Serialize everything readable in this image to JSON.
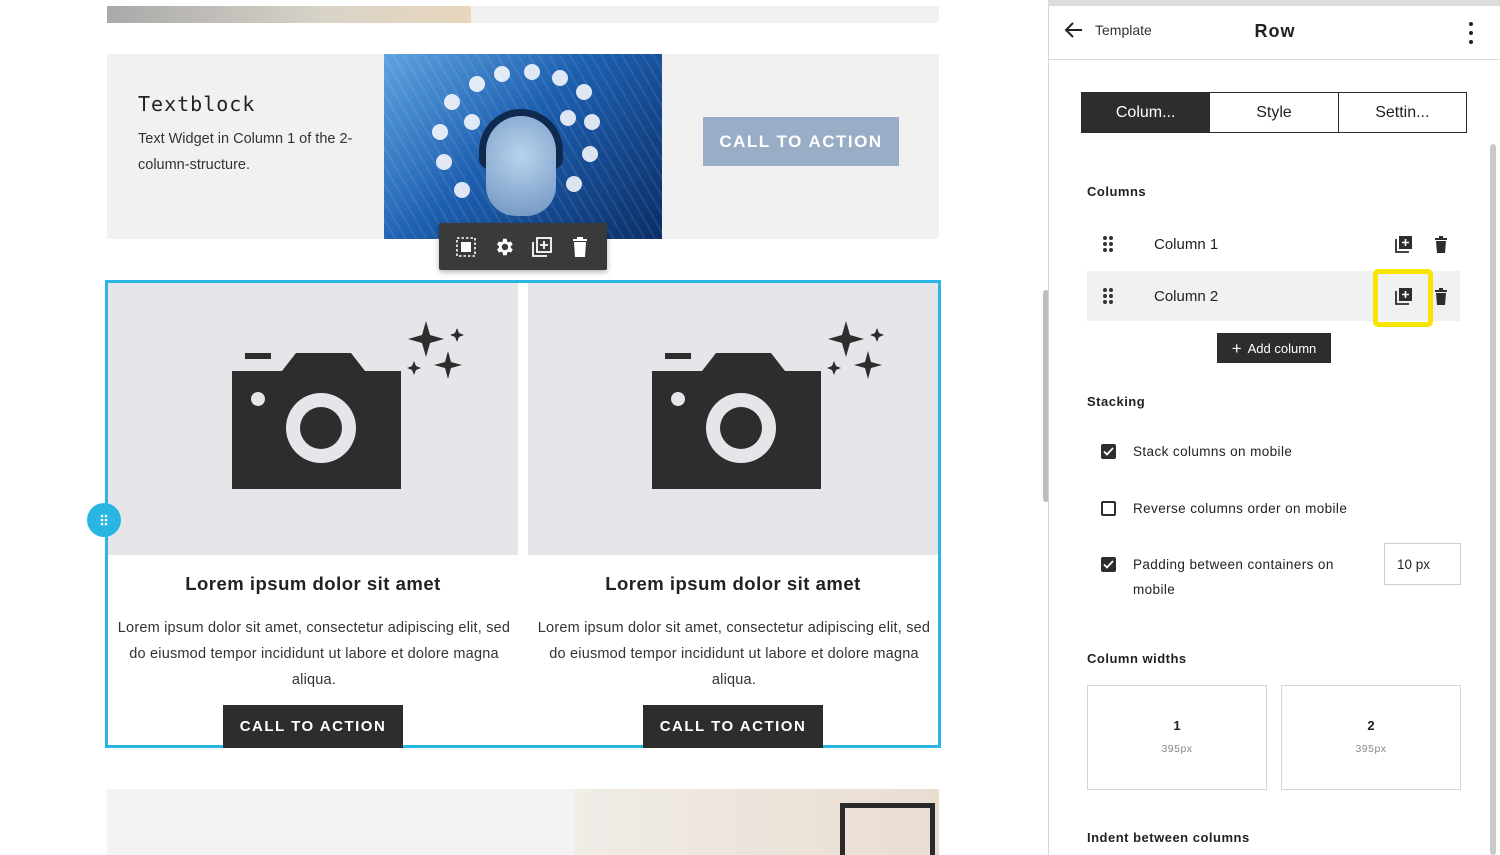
{
  "canvas": {
    "textblock": {
      "title": "Textblock",
      "text": "Text Widget in Column 1 of the 2-column-structure."
    },
    "top_cta_label": "CALL TO ACTION",
    "columns": [
      {
        "heading": "Lorem ipsum dolor sit amet",
        "body": "Lorem ipsum dolor sit amet, consectetur adipiscing elit, sed do eiusmod tempor incididunt ut labore et dolore magna aliqua.",
        "cta_label": "CALL TO ACTION"
      },
      {
        "heading": "Lorem ipsum dolor sit amet",
        "body": "Lorem ipsum dolor sit amet, consectetur adipiscing elit, sed do eiusmod tempor incididunt ut labore et dolore magna aliqua.",
        "cta_label": "CALL TO ACTION"
      }
    ],
    "toolbar_icons": [
      "select-parent-icon",
      "gear-icon",
      "duplicate-icon",
      "trash-icon"
    ]
  },
  "panel": {
    "back_label": "Template",
    "title": "Row",
    "tabs": [
      {
        "label": "Colum...",
        "active": true
      },
      {
        "label": "Style",
        "active": false
      },
      {
        "label": "Settin...",
        "active": false
      }
    ],
    "columns_section": {
      "label": "Columns",
      "items": [
        {
          "label": "Column 1"
        },
        {
          "label": "Column 2"
        }
      ],
      "add_label": "Add column"
    },
    "stacking_section": {
      "label": "Stacking",
      "options": [
        {
          "label": "Stack columns on mobile",
          "checked": true
        },
        {
          "label": "Reverse columns order on mobile",
          "checked": false
        },
        {
          "label": "Padding between containers on mobile",
          "checked": true
        }
      ],
      "padding_value": "10 px"
    },
    "widths_section": {
      "label": "Column widths",
      "cards": [
        {
          "num": "1",
          "px": "395px"
        },
        {
          "num": "2",
          "px": "395px"
        }
      ]
    },
    "indent_label": "Indent between columns"
  },
  "colors": {
    "accent": "#29b6e3",
    "dark": "#2d2d2d",
    "highlight": "#f7e400",
    "cta_muted": "#9aadc6"
  }
}
